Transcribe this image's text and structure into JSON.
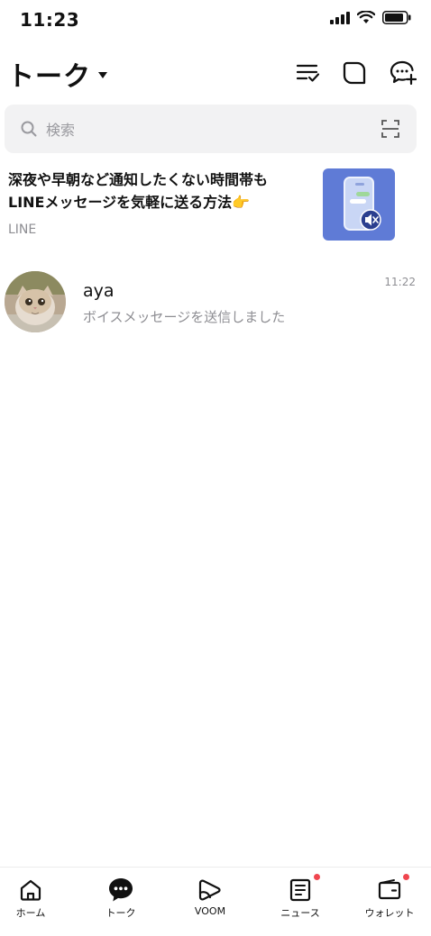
{
  "status_bar": {
    "time": "11:23"
  },
  "header": {
    "title": "トーク"
  },
  "search": {
    "placeholder": "検索"
  },
  "promo": {
    "line1": "深夜や早朝など通知したくない時間帯も",
    "line2": "LINEメッセージを気軽に送る方法👉",
    "source": "LINE"
  },
  "chats": [
    {
      "name": "aya",
      "message": "ボイスメッセージを送信しました",
      "time": "11:22"
    }
  ],
  "nav": {
    "items": [
      {
        "label": "ホーム",
        "icon": "home-icon"
      },
      {
        "label": "トーク",
        "icon": "chat-bubble-icon"
      },
      {
        "label": "VOOM",
        "icon": "voom-play-icon"
      },
      {
        "label": "ニュース",
        "icon": "news-icon"
      },
      {
        "label": "ウォレット",
        "icon": "wallet-icon"
      }
    ],
    "active_index": 1,
    "badge_color": "#f0464f"
  },
  "colors": {
    "promo_bg": "#5f7bd6",
    "search_bg": "#f2f2f3"
  }
}
